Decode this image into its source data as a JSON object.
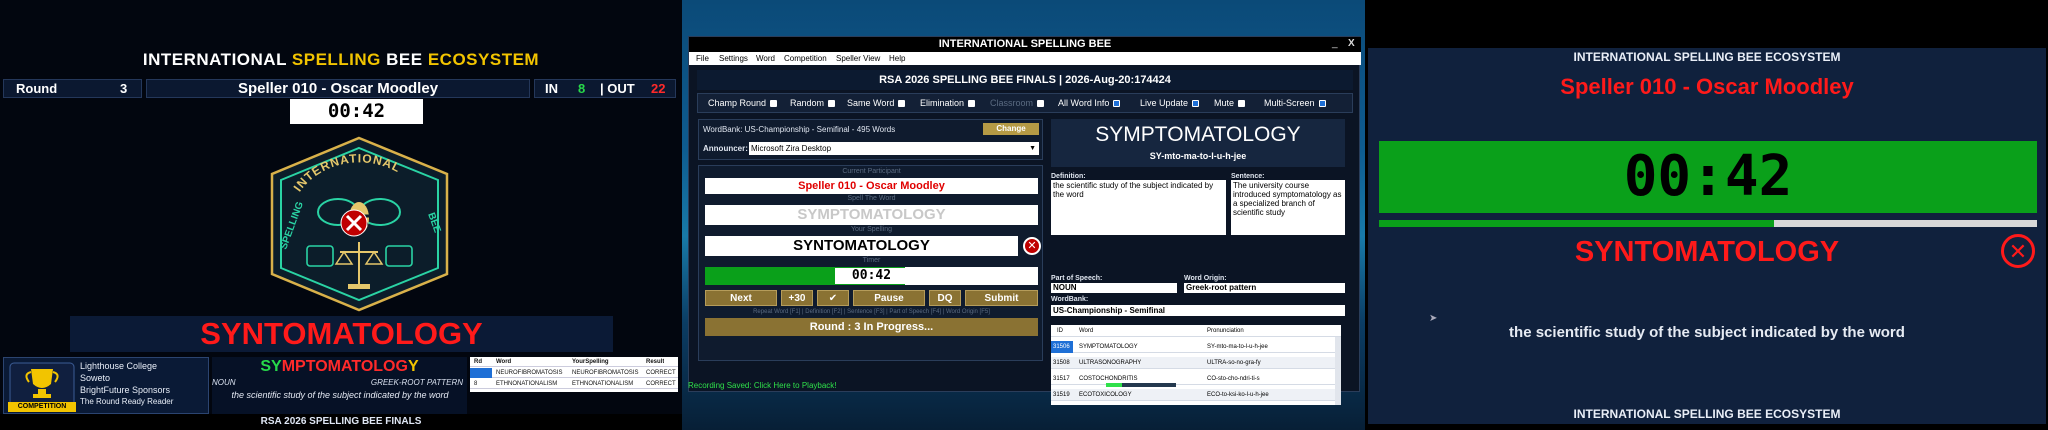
{
  "left": {
    "title": {
      "w1": "INTERNATIONAL",
      "y1": "SPELLING",
      "w2": "BEE",
      "y2": "ECOSYSTEM"
    },
    "round_label": "Round",
    "round_value": "3",
    "speller": "Speller 010 - Oscar Moodley",
    "in_label": "IN",
    "in_value": "8",
    "out_label": "| OUT",
    "out_value": "22",
    "timer": "00:42",
    "logo_text": {
      "top": "INTERNATIONAL",
      "left": "SPELLING",
      "right": "BEE"
    },
    "word_display": "SYNTOMATOLOGY",
    "sponsor": {
      "badge": "COMPETITION",
      "lines": [
        "Lighthouse College",
        "Soweto",
        "BrightFuture Sponsors",
        "The Round Ready Reader"
      ]
    },
    "diff_word": {
      "p1": "SY",
      "p2": "MPTOMATOLOG",
      "p3": "Y"
    },
    "pos": "NOUN",
    "origin": "GREEK-ROOT PATTERN",
    "definition": "the scientific study of the subject indicated by the word",
    "history": {
      "headers": [
        "Rd",
        "Word",
        "YourSpelling",
        "Result"
      ],
      "rows": [
        [
          "",
          "NEUROFIBROMATOSIS",
          "NEUROFIBROMATOSIS",
          "CORRECT"
        ],
        [
          "8",
          "ETHNONATIONALISM",
          "ETHNONATIONALISM",
          "CORRECT"
        ]
      ]
    },
    "footer": "RSA 2026 SPELLING BEE FINALS"
  },
  "middle": {
    "window_title": "INTERNATIONAL SPELLING BEE",
    "win_controls": {
      "min": "_",
      "close": "X"
    },
    "menu": [
      "File",
      "Settings",
      "Word",
      "Competition",
      "Speller View",
      "Help"
    ],
    "header": "RSA 2026 SPELLING BEE FINALS | 2026-Aug-20:174424",
    "options": [
      {
        "label": "Champ Round",
        "on": false
      },
      {
        "label": "Random",
        "on": false
      },
      {
        "label": "Same Word",
        "on": false
      },
      {
        "label": "Elimination",
        "on": false
      },
      {
        "label": "Classroom",
        "on": false
      },
      {
        "label": "All Word Info",
        "on": true
      },
      {
        "label": "Live Update",
        "on": true
      },
      {
        "label": "Mute",
        "on": false
      },
      {
        "label": "Multi-Screen",
        "on": true
      }
    ],
    "wordbank": "WordBank: US-Championship - Semifinal - 495 Words",
    "change_button": "Change",
    "announcer_label": "Announcer:",
    "announcer_value": "Microsoft Zira Desktop",
    "current_participant_label": "Current Participant",
    "current_participant": "Speller 010 - Oscar Moodley",
    "spell_word_label": "Spell The Word",
    "spell_word": "SYMPTOMATOLOGY",
    "your_spelling_label": "Your Spelling",
    "your_spelling": "SYNTOMATOLOGY",
    "timer_label": "Timer",
    "timer": "00:42",
    "buttons": {
      "next": "Next",
      "plus30": "+30",
      "check": "✔",
      "pause": "Pause",
      "dq": "DQ",
      "submit": "Submit"
    },
    "shortcut_hint": "Repeat Word [F1] | Definition [F2] | Sentence [F3] | Part of Speech [F4] | Word Origin [F5]",
    "round_status": "Round :  3 In Progress...",
    "word_title": "SYMPTOMATOLOGY",
    "pronunciation": "SY-mto-ma-to-l-u-h-jee",
    "definition_label": "Definition:",
    "definition": "the scientific study of the subject indicated by the word",
    "sentence_label": "Sentence:",
    "sentence": "The university course introduced symptomatology as a specialized branch of scientific study",
    "pos_label": "Part of Speech:",
    "pos": "NOUN",
    "origin_label": "Word Origin:",
    "origin": "Greek-root pattern",
    "wordbank_label": "WordBank:",
    "wordbank_value": "US-Championship - Semifinal",
    "table": {
      "headers": [
        "ID",
        "Word",
        "Pronunciation"
      ],
      "rows": [
        [
          "31506",
          "SYMPTOMATOLOGY",
          "SY-mto-ma-to-l-u-h-jee"
        ],
        [
          "31508",
          "ULTRASONOGRAPHY",
          "ULTRA-so-no-gra-fy"
        ],
        [
          "31517",
          "COSTOCHONDRITIS",
          "CO-sto-cho-ndri-ti-s"
        ],
        [
          "31519",
          "ECOTOXICOLOGY",
          "ECO-to-ksi-ko-l-u-h-jee"
        ]
      ]
    },
    "status": "Recording Saved: Click Here to Playback!"
  },
  "right": {
    "head": "INTERNATIONAL SPELLING BEE ECOSYSTEM",
    "speller": "Speller 010 - Oscar Moodley",
    "timer": "00:42",
    "timer_progress": 0.6,
    "word": "SYNTOMATOLOGY",
    "definition": "the scientific study of the subject indicated by the word",
    "foot": "INTERNATIONAL SPELLING BEE ECOSYSTEM"
  },
  "colors": {
    "accent_yellow": "#f2c400",
    "error_red": "#ff1a1a",
    "timer_green": "#0aa01a",
    "gold_button": "#8a7233"
  }
}
